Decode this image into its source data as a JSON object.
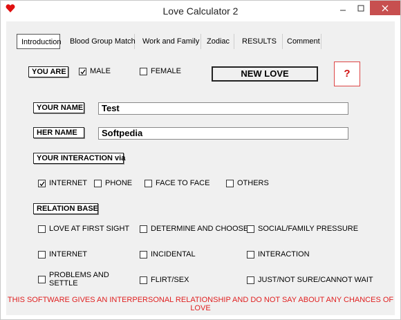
{
  "window": {
    "title": "Love Calculator 2"
  },
  "tabs": [
    "Introduction",
    "Blood Group Match",
    "Work and Family",
    "Zodiac",
    "RESULTS",
    "Comment"
  ],
  "you_are": {
    "label": "YOU ARE",
    "male": {
      "label": "MALE",
      "checked": true
    },
    "female": {
      "label": "FEMALE",
      "checked": false
    }
  },
  "buttons": {
    "new_love": "NEW LOVE",
    "help": "?"
  },
  "your_name": {
    "label": "YOUR NAME",
    "value": "Test"
  },
  "her_name": {
    "label": "HER NAME",
    "value": "Softpedia"
  },
  "interaction": {
    "label": "YOUR INTERACTION via",
    "options": [
      {
        "label": "INTERNET",
        "checked": true
      },
      {
        "label": "PHONE",
        "checked": false
      },
      {
        "label": "FACE TO FACE",
        "checked": false
      },
      {
        "label": "OTHERS",
        "checked": false
      }
    ]
  },
  "relation": {
    "label": "RELATION BASE",
    "options": [
      {
        "label": "LOVE AT FIRST SIGHT",
        "checked": false
      },
      {
        "label": "DETERMINE AND CHOOSE",
        "checked": false
      },
      {
        "label": "SOCIAL/FAMILY PRESSURE",
        "checked": false
      },
      {
        "label": "INTERNET",
        "checked": false
      },
      {
        "label": "INCIDENTAL",
        "checked": false
      },
      {
        "label": "INTERACTION",
        "checked": false
      },
      {
        "label": "PROBLEMS AND\nSETTLE",
        "checked": false
      },
      {
        "label": "FLIRT/SEX",
        "checked": false
      },
      {
        "label": "JUST/NOT SURE/CANNOT WAIT",
        "checked": false
      }
    ]
  },
  "footer": "THIS SOFTWARE GIVES AN INTERPERSONAL RELATIONSHIP  AND DO NOT SAY ABOUT ANY CHANCES OF LOVE",
  "colors": {
    "accent_red": "#e02020",
    "close_button": "#c74f4f"
  }
}
